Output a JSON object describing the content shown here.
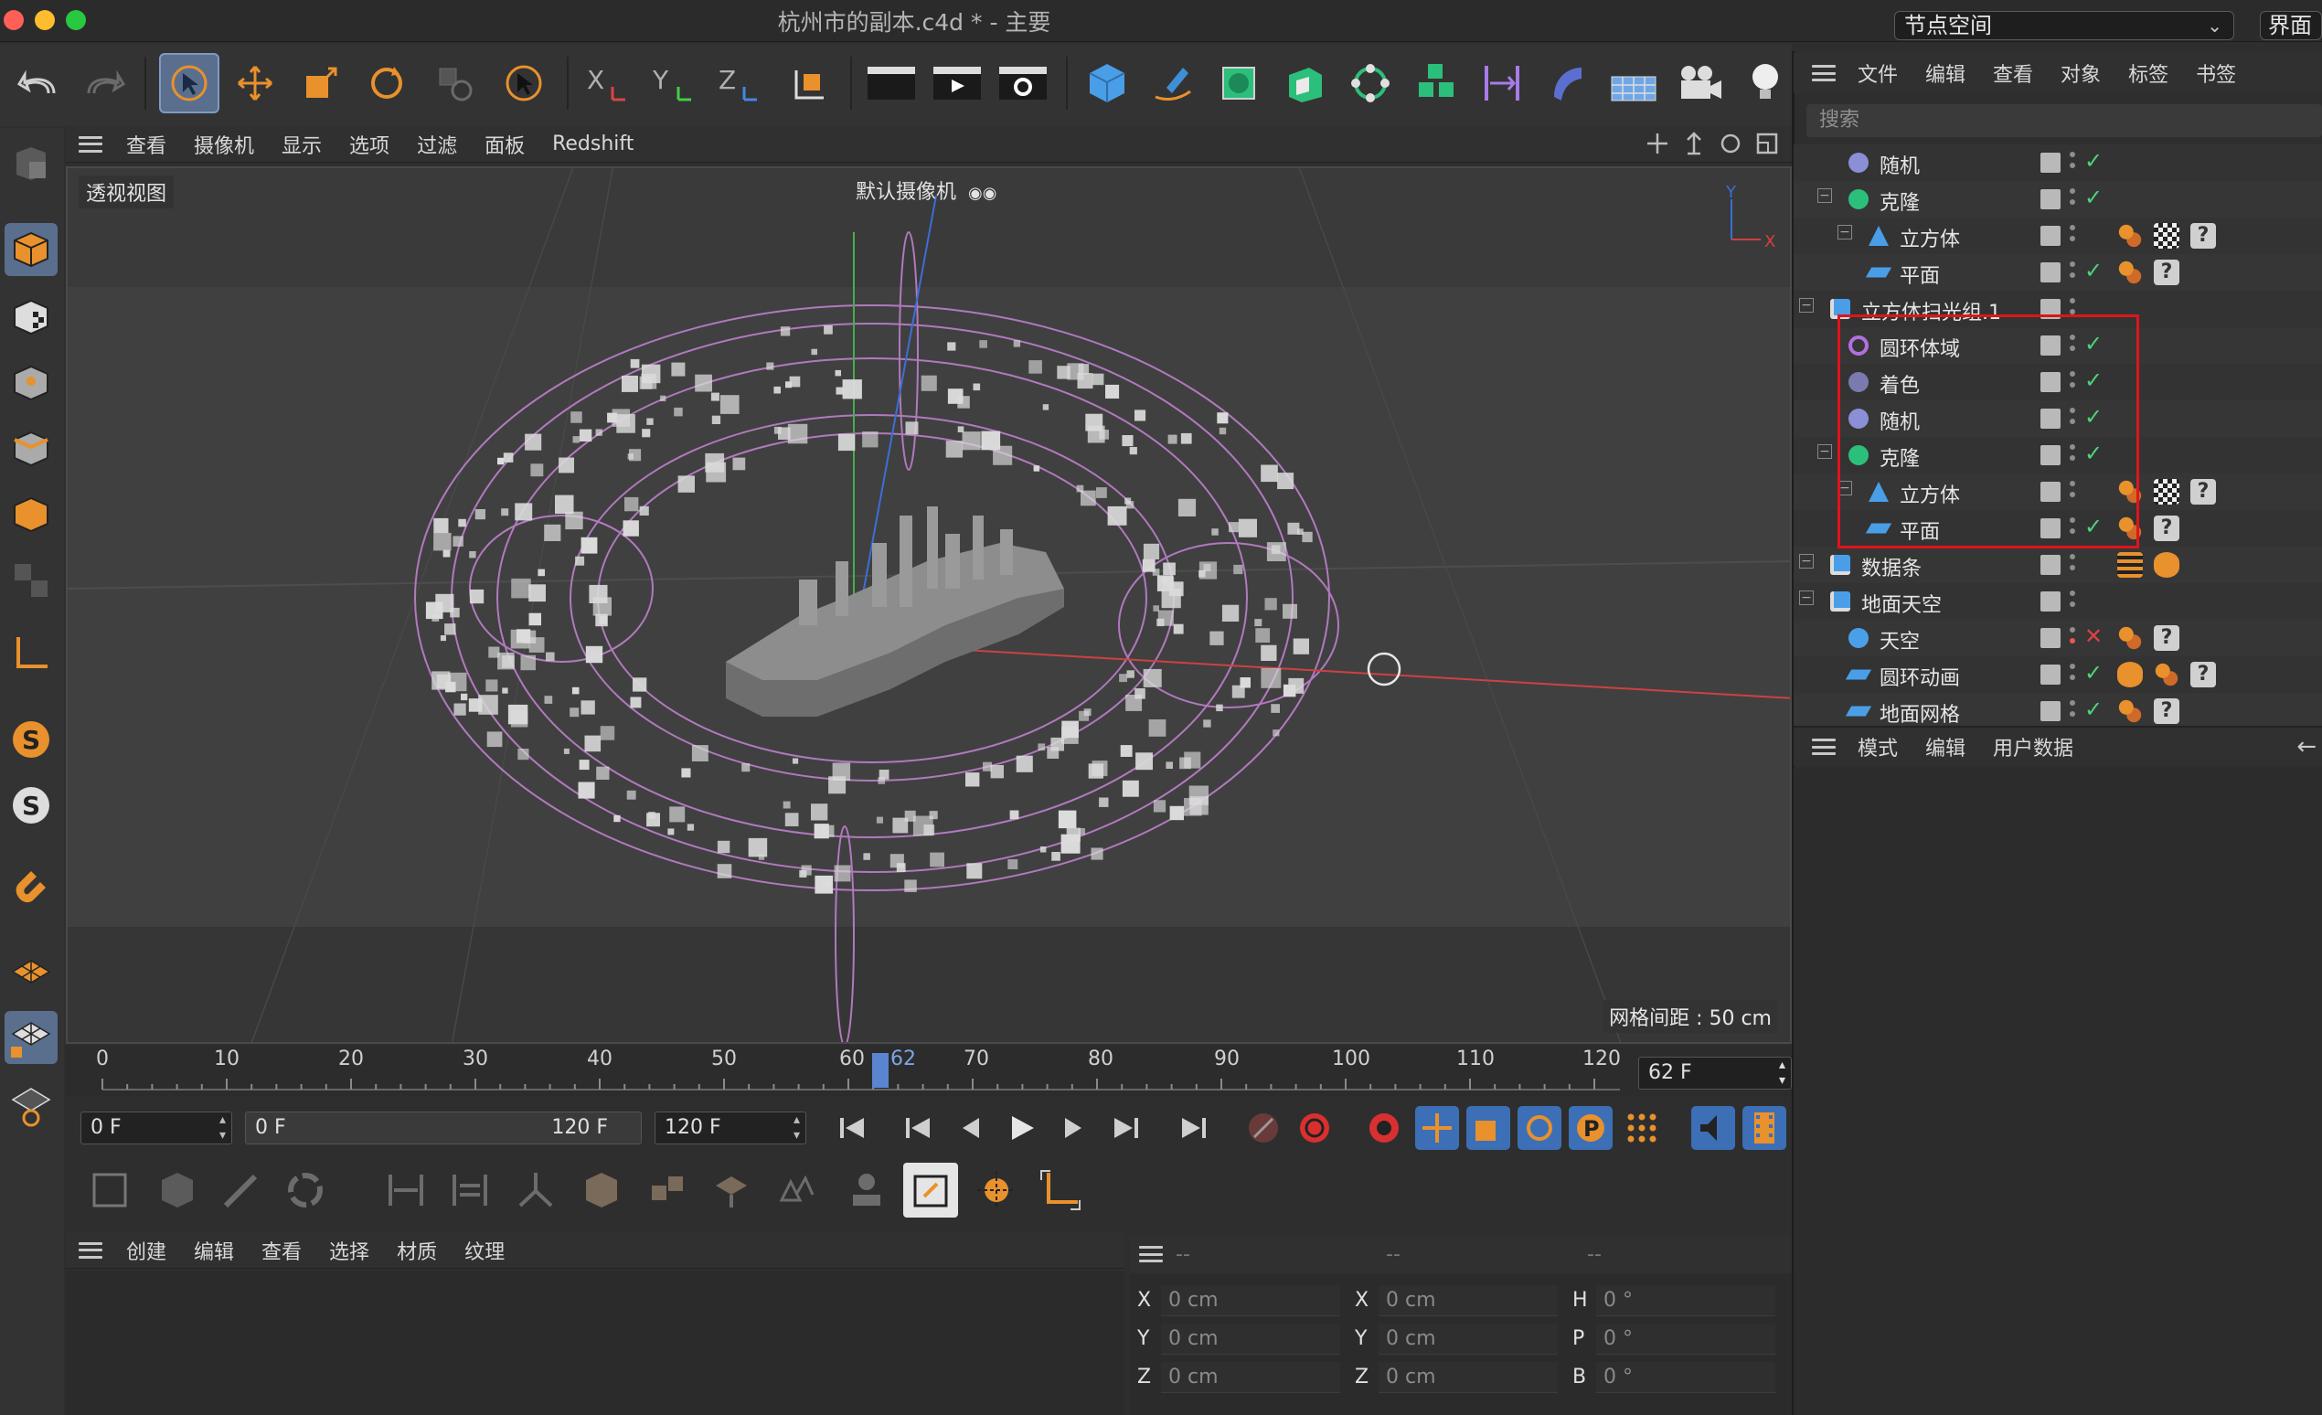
{
  "window": {
    "title": "杭州市的副本.c4d * - 主要",
    "layout_select": "节点空间",
    "ui_button": "界面"
  },
  "viewport_menu": [
    "查看",
    "摄像机",
    "显示",
    "选项",
    "过滤",
    "面板",
    "Redshift"
  ],
  "viewport": {
    "view_name": "透视视图",
    "camera_name": "默认摄像机",
    "grid_spacing": "网格间距 : 50 cm",
    "axis_y": "Y",
    "axis_x": "X"
  },
  "timeline": {
    "ticks": [
      "0",
      "10",
      "20",
      "30",
      "40",
      "50",
      "60",
      "70",
      "80",
      "90",
      "100",
      "110",
      "120"
    ],
    "current_frame_marker": "62",
    "current_frame_field": "62 F",
    "start_field": "0 F",
    "range_start": "0 F",
    "range_end": "120 F",
    "end_field": "120 F"
  },
  "material_menu": [
    "创建",
    "编辑",
    "查看",
    "选择",
    "材质",
    "纹理"
  ],
  "coordinates": {
    "headers": [
      "--",
      "--",
      "--"
    ],
    "rows": [
      {
        "l1": "X",
        "v1": "0 cm",
        "l2": "X",
        "v2": "0 cm",
        "l3": "H",
        "v3": "0 °"
      },
      {
        "l1": "Y",
        "v1": "0 cm",
        "l2": "Y",
        "v2": "0 cm",
        "l3": "P",
        "v3": "0 °"
      },
      {
        "l1": "Z",
        "v1": "0 cm",
        "l2": "Z",
        "v2": "0 cm",
        "l3": "B",
        "v3": "0 °"
      }
    ]
  },
  "object_manager": {
    "menu": [
      "文件",
      "编辑",
      "查看",
      "对象",
      "标签",
      "书签"
    ],
    "search_placeholder": "搜索",
    "rows": [
      {
        "name": "随机",
        "icon": "random-effector-icon",
        "status": "check"
      },
      {
        "name": "克隆",
        "icon": "cloner-icon",
        "status": "check"
      },
      {
        "name": "立方体",
        "icon": "cube-icon",
        "status": ""
      },
      {
        "name": "平面",
        "icon": "plane-icon",
        "status": "check"
      },
      {
        "name": "立方体扫光组.1",
        "icon": "null-group-icon",
        "status": ""
      },
      {
        "name": "圆环体域",
        "icon": "torus-field-icon",
        "status": "check"
      },
      {
        "name": "着色",
        "icon": "shader-effector-icon",
        "status": "check"
      },
      {
        "name": "随机",
        "icon": "random-effector-icon",
        "status": "check"
      },
      {
        "name": "克隆",
        "icon": "cloner-icon",
        "status": "check"
      },
      {
        "name": "立方体",
        "icon": "cube-icon",
        "status": ""
      },
      {
        "name": "平面",
        "icon": "plane-icon",
        "status": "check"
      },
      {
        "name": "数据条",
        "icon": "null-group-icon",
        "status": ""
      },
      {
        "name": "地面天空",
        "icon": "null-group-icon",
        "status": ""
      },
      {
        "name": "天空",
        "icon": "sky-icon",
        "status": "cross"
      },
      {
        "name": "圆环动画",
        "icon": "plane-icon",
        "status": "check"
      },
      {
        "name": "地面网格",
        "icon": "plane-icon",
        "status": "check"
      }
    ]
  },
  "attribute_manager": {
    "menu": [
      "模式",
      "编辑",
      "用户数据"
    ]
  },
  "colors": {
    "accent_orange": "#e8912d",
    "selected_blue": "#5a6f8e",
    "highlight_red": "#e0141b",
    "check_green": "#4ed37a"
  }
}
